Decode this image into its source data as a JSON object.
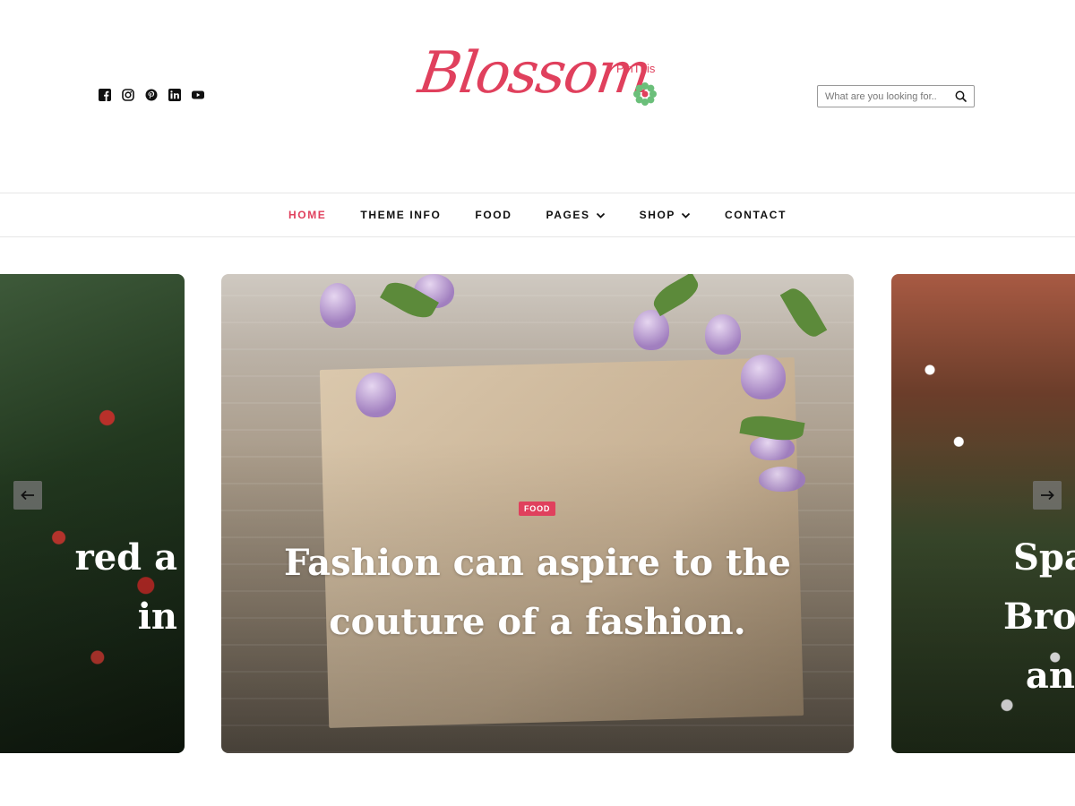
{
  "header": {
    "social_icons": [
      "facebook-icon",
      "instagram-icon",
      "pinterest-icon",
      "linkedin-icon",
      "youtube-icon"
    ],
    "logo": {
      "text": "Blossom",
      "tagline": "PinThis"
    },
    "search": {
      "placeholder": "What are you looking for.."
    }
  },
  "nav": {
    "items": [
      {
        "label": "HOME",
        "active": true,
        "has_dropdown": false
      },
      {
        "label": "THEME INFO",
        "active": false,
        "has_dropdown": false
      },
      {
        "label": "FOOD",
        "active": false,
        "has_dropdown": false
      },
      {
        "label": "PAGES",
        "active": false,
        "has_dropdown": true
      },
      {
        "label": "SHOP",
        "active": false,
        "has_dropdown": true
      },
      {
        "label": "CONTACT",
        "active": false,
        "has_dropdown": false
      }
    ]
  },
  "slider": {
    "prev_slide": {
      "title_lines": [
        "red a",
        "in"
      ]
    },
    "current_slide": {
      "category": "FOOD",
      "title": "Fashion can aspire to the couture of a fashion."
    },
    "next_slide": {
      "title_lines": [
        "Spa",
        "Brov",
        "an"
      ]
    }
  },
  "colors": {
    "accent": "#e0405d",
    "text": "#111111",
    "border": "#e6e6e6"
  }
}
